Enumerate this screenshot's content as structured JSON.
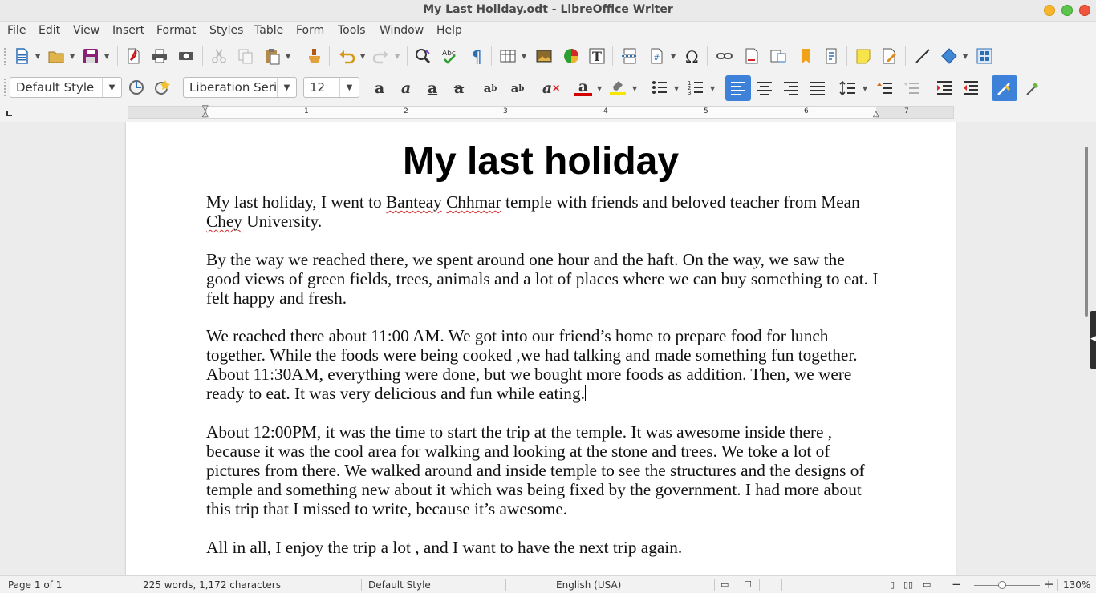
{
  "window": {
    "title": "My Last Holiday.odt - LibreOffice Writer"
  },
  "menu": {
    "items": [
      "File",
      "Edit",
      "View",
      "Insert",
      "Format",
      "Styles",
      "Table",
      "Form",
      "Tools",
      "Window",
      "Help"
    ],
    "close_glyph": "✕"
  },
  "formatting": {
    "paragraph_style": "Default Style",
    "font_name": "Liberation Seri",
    "font_size": "12"
  },
  "ruler": {
    "numbers": [
      "1",
      "2",
      "3",
      "4",
      "5",
      "6",
      "7"
    ]
  },
  "document": {
    "title": "My last holiday",
    "p1": {
      "before": "My last holiday, I went to ",
      "misspelled_1": "Banteay",
      "space": " ",
      "misspelled_2": "Chhmar",
      "middle": " temple with friends and beloved teacher from Mean ",
      "misspelled_3": "Chey",
      "after": " University."
    },
    "p2": "By the way we reached there, we spent  around one hour and the haft. On the way, we saw the good views of green fields, trees, animals and a lot of places where we can buy something to eat. I felt happy and fresh.",
    "p3": "We reached there about 11:00 AM. We got into our friend’s home to prepare food for lunch together. While the foods were being cooked ,we had talking and made something fun together. About 11:30AM, everything were done, but we bought more foods as addition. Then, we were ready to eat. It was very delicious and fun while eating.",
    "p4": "About 12:00PM, it was the time to start the trip at the temple. It was awesome inside there , because it was the cool area for walking and looking at the stone and trees. We toke a lot of pictures from there. We walked around and inside temple to see the structures and the designs of temple and something new about it which was being fixed by the government. I had more about this trip that I missed to write, because it’s awesome.",
    "p5": "All in all, I enjoy the trip a lot , and I want to have the next trip again."
  },
  "status": {
    "page": "Page 1 of 1",
    "words": "225 words, 1,172 characters",
    "style": "Default Style",
    "language": "English (USA)",
    "zoom_minus": "−",
    "zoom_plus": "+",
    "zoom": "130%"
  },
  "colors": {
    "accent": "#3d82d8",
    "font_color_bar": "#d40000",
    "highlight_bar": "#f5e500"
  }
}
